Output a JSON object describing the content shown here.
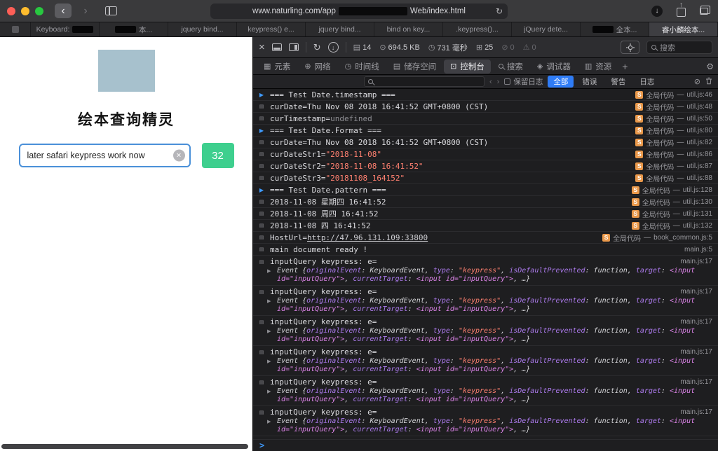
{
  "colors": {
    "accent_blue": "#2f7cf6",
    "button_green": "#3ecf8e",
    "string_red": "#ff8070",
    "badge_orange": "#e9984a",
    "traffic_red": "#ff5f57",
    "traffic_yellow": "#febc2e",
    "traffic_green": "#28c840",
    "image_placeholder": "#a7c1cd"
  },
  "titlebar": {
    "url_pre": "www.naturling.com/app",
    "url_post": "Web/index.html"
  },
  "tab_bar": {
    "tabs": [
      {
        "pinned": true,
        "label": ""
      },
      {
        "label": "Keyboard:",
        "censor": "after"
      },
      {
        "label": "本...",
        "censor": "before"
      },
      {
        "label": "jquery bind..."
      },
      {
        "label": "keypress() e..."
      },
      {
        "label": "jquery bind..."
      },
      {
        "label": "bind on key..."
      },
      {
        "label": ".keypress()..."
      },
      {
        "label": "jQuery dete..."
      },
      {
        "label": "全本...",
        "censor": "before"
      },
      {
        "label": "睿小麟绘本...",
        "active": true
      }
    ]
  },
  "page": {
    "title": "绘本查询精灵",
    "input_value": "later safari keypress work now",
    "count_button": "32"
  },
  "inspector": {
    "toolbar": {
      "stats": [
        {
          "icon": "document-icon",
          "value": "14"
        },
        {
          "icon": "data-icon",
          "value": "694.5 KB"
        },
        {
          "icon": "time-icon",
          "value": "731 毫秒"
        },
        {
          "icon": "resource-icon",
          "value": "25"
        },
        {
          "icon": "issues-icon",
          "value": "0",
          "dim": true
        },
        {
          "icon": "warnings-icon",
          "value": "0",
          "dim": true
        }
      ],
      "search_placeholder": "搜索"
    },
    "tabs": [
      {
        "key": "elements",
        "icon": "elements-icon",
        "label": "元素"
      },
      {
        "key": "network",
        "icon": "network-icon",
        "label": "网络"
      },
      {
        "key": "timelines",
        "icon": "timelines-icon",
        "label": "时间线"
      },
      {
        "key": "storage",
        "icon": "storage-icon",
        "label": "储存空间"
      },
      {
        "key": "console",
        "icon": "console-icon",
        "label": "控制台",
        "active": true
      },
      {
        "key": "search",
        "icon": "search-icon",
        "label": "搜索"
      },
      {
        "key": "debugger",
        "icon": "debugger-icon",
        "label": "调试器"
      },
      {
        "key": "resources",
        "icon": "resources-icon",
        "label": "资源"
      }
    ],
    "filter": {
      "preserve_log": "保留日志",
      "scopes": [
        {
          "key": "all",
          "label": "全部",
          "active": true
        },
        {
          "key": "errors",
          "label": "错误"
        },
        {
          "key": "warnings",
          "label": "警告"
        },
        {
          "key": "logs",
          "label": "日志"
        }
      ]
    },
    "console": {
      "rows": [
        {
          "info": true,
          "pre": "=== Test Date.timestamp ===",
          "badge": true,
          "scope": "全局代码",
          "loc": "util.js:46"
        },
        {
          "pre": "curDate=Thu Nov 08 2018 16:41:52 GMT+0800 (CST)",
          "badge": true,
          "scope": "全局代码",
          "loc": "util.js:48"
        },
        {
          "pre": "curTimestamp=",
          "dim": "undefined",
          "badge": true,
          "scope": "全局代码",
          "loc": "util.js:50"
        },
        {
          "info": true,
          "pre": "=== Test Date.Format ===",
          "badge": true,
          "scope": "全局代码",
          "loc": "util.js:80"
        },
        {
          "pre": "curDate=Thu Nov 08 2018 16:41:52 GMT+0800 (CST)",
          "badge": true,
          "scope": "全局代码",
          "loc": "util.js:82"
        },
        {
          "pre": "curDateStr1=",
          "str": "\"2018-11-08\"",
          "badge": true,
          "scope": "全局代码",
          "loc": "util.js:86"
        },
        {
          "pre": "curDateStr2=",
          "str": "\"2018-11-08 16:41:52\"",
          "badge": true,
          "scope": "全局代码",
          "loc": "util.js:87"
        },
        {
          "pre": "curDateStr3=",
          "str": "\"20181108_164152\"",
          "badge": true,
          "scope": "全局代码",
          "loc": "util.js:88"
        },
        {
          "info": true,
          "pre": "=== Test Date.pattern ===",
          "badge": true,
          "scope": "全局代码",
          "loc": "util.js:128"
        },
        {
          "pre": "2018-11-08 星期四 16:41:52",
          "badge": true,
          "scope": "全局代码",
          "loc": "util.js:130"
        },
        {
          "pre": "2018-11-08 周四 16:41:52",
          "badge": true,
          "scope": "全局代码",
          "loc": "util.js:131"
        },
        {
          "pre": "2018-11-08 四 16:41:52",
          "badge": true,
          "scope": "全局代码",
          "loc": "util.js:132"
        },
        {
          "pre": "HostUrl=",
          "link": "http://47.96.131.109:33800",
          "badge": true,
          "scope": "全局代码",
          "loc": "book_common.js:5"
        },
        {
          "pre": "main document ready !",
          "loc": "main.js:5"
        }
      ],
      "keypress": {
        "repeat": 6,
        "line": "inputQuery keypress: e=",
        "loc": "main.js:17",
        "event_preview": [
          {
            "t": "Event {",
            "c": "obj"
          },
          {
            "t": "originalEvent",
            "c": "key"
          },
          {
            "t": ": KeyboardEvent, ",
            "c": "obj"
          },
          {
            "t": "type",
            "c": "key"
          },
          {
            "t": ": ",
            "c": "obj"
          },
          {
            "t": "\"keypress\"",
            "c": "str"
          },
          {
            "t": ", ",
            "c": "obj"
          },
          {
            "t": "isDefaultPrevented",
            "c": "key"
          },
          {
            "t": ": function, ",
            "c": "obj"
          },
          {
            "t": "target",
            "c": "key"
          },
          {
            "t": ": ",
            "c": "obj"
          },
          {
            "t": "<input id=\"inputQuery\">",
            "c": "node"
          },
          {
            "t": ", ",
            "c": "obj"
          },
          {
            "t": "currentTarget",
            "c": "key"
          },
          {
            "t": ": ",
            "c": "obj"
          },
          {
            "t": "<input id=\"inputQuery\">",
            "c": "node"
          },
          {
            "t": ", …}",
            "c": "obj"
          }
        ]
      },
      "prompt_char": ">"
    }
  }
}
